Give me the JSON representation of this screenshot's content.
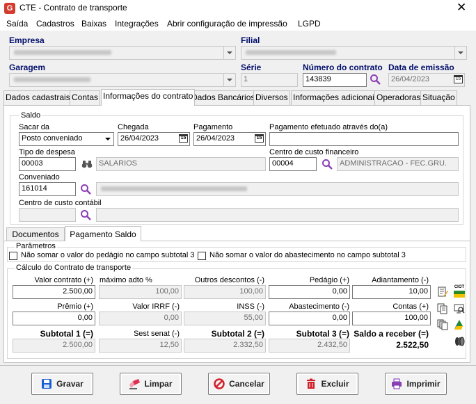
{
  "window": {
    "title": "CTE - Contrato de transporte",
    "close": "✕",
    "app_icon_letter": "G"
  },
  "menu": [
    "Saída",
    "Cadastros",
    "Baixas",
    "Integrações",
    "Abrir configuração de impressão",
    "LGPD"
  ],
  "header": {
    "empresa_label": "Empresa",
    "filial_label": "Filial",
    "garagem_label": "Garagem",
    "serie_label": "Série",
    "serie_value": "1",
    "numero_label": "Número do contrato",
    "numero_value": "143839",
    "data_emissao_label": "Data de emissão",
    "data_emissao_value": "26/04/2023"
  },
  "tabs": [
    "Dados cadastrais",
    "Contas",
    "Informações do contrato",
    "Dados Bancários",
    "Diversos",
    "Informações adicionais",
    "Operadoras",
    "Situação"
  ],
  "saldo": {
    "group_label": "Saldo",
    "sacar_da_label": "Sacar da",
    "sacar_da_value": "Posto conveniado",
    "chegada_label": "Chegada",
    "chegada_value": "26/04/2023",
    "pagamento_label": "Pagamento",
    "pagamento_value": "26/04/2023",
    "pagamento_atraves_label": "Pagamento efetuado através do(a)",
    "pagamento_atraves_value": "",
    "tipo_despesa_label": "Tipo de despesa",
    "tipo_despesa_code": "00003",
    "tipo_despesa_desc": "SALARIOS",
    "centro_fin_label": "Centro de custo financeiro",
    "centro_fin_code": "00004",
    "centro_fin_desc": "ADMINISTRACAO - FEC.GRU.",
    "conveniado_label": "Conveniado",
    "conveniado_code": "161014",
    "centro_contabil_label": "Centro de custo contábil"
  },
  "subtabs": [
    "Documentos",
    "Pagamento Saldo"
  ],
  "parametros": {
    "group_label": "Parâmetros",
    "opt1": "Não somar o valor do pedágio no campo subtotal 3",
    "opt2": "Não somar o valor do abastecimento no campo subtotal 3"
  },
  "calculo": {
    "group_label": "Cálculo do Contrato de transporte",
    "valor_contrato_label": "Valor contrato (+)",
    "valor_contrato": "2.500,00",
    "max_adto_label": "máximo adto %",
    "max_adto": "100,00",
    "outros_descontos_label": "Outros descontos (-)",
    "outros_descontos": "100,00",
    "pedagio_label": "Pedágio (+)",
    "pedagio": "0,00",
    "adiantamento_label": "Adiantamento (-)",
    "adiantamento": "10,00",
    "premio_label": "Prêmio (+)",
    "premio": "0,00",
    "irrf_label": "Valor IRRF (-)",
    "irrf": "0,00",
    "inss_label": "INSS (-)",
    "inss": "55,00",
    "abastecimento_label": "Abastecimento (-)",
    "abastecimento": "0,00",
    "contas_label": "Contas (+)",
    "contas": "100,00",
    "subtotal1_label": "Subtotal 1 (=)",
    "subtotal1": "2.500,00",
    "sest_senat_label": "Sest senat (-)",
    "sest_senat": "12,50",
    "subtotal2_label": "Subtotal 2 (=)",
    "subtotal2": "2.332,50",
    "subtotal3_label": "Subtotal 3 (=)",
    "subtotal3": "2.432,50",
    "saldo_receber_label": "Saldo a receber (=)",
    "saldo_receber": "2.522,50"
  },
  "side_icons": {
    "ciot_label": "CIOT"
  },
  "buttons": {
    "gravar": "Gravar",
    "limpar": "Limpar",
    "cancelar": "Cancelar",
    "excluir": "Excluir",
    "imprimir": "Imprimir"
  },
  "colors": {
    "accent_label": "#000d6b",
    "search_icon": "#8b3fb5",
    "title_icon": "#d23c2e"
  }
}
